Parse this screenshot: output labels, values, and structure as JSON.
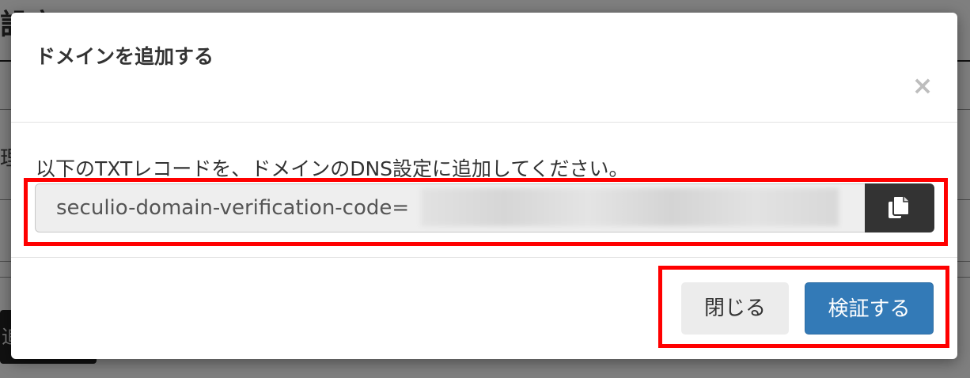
{
  "background": {
    "title_fragment": "設定",
    "side_text": "理",
    "dark_button_fragment": "追"
  },
  "modal": {
    "title": "ドメインを追加する",
    "close_icon": "×",
    "instruction": "以下のTXTレコードを、ドメインのDNS設定に追加してください。",
    "verification_code": "seculio-domain-verification-code=",
    "copy_icon": "copy-icon",
    "buttons": {
      "close_label": "閉じる",
      "verify_label": "検証する"
    }
  },
  "colors": {
    "primary": "#337ab7",
    "highlight": "#ff0000",
    "copy_button": "#333333"
  }
}
